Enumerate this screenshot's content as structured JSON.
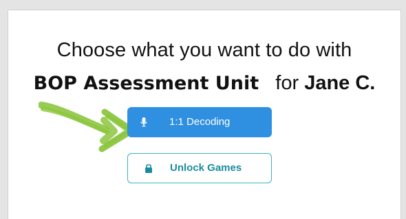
{
  "prompt": {
    "line1": "Choose what you want to do with",
    "unit_name": "BOP Assessment Unit",
    "connector": "for",
    "student_name": "Jane C."
  },
  "actions": {
    "decoding": {
      "label": "1:1 Decoding",
      "icon": "microphone-icon"
    },
    "unlock_games": {
      "label": "Unlock Games",
      "icon": "lock-icon"
    }
  },
  "colors": {
    "primary_button": "#2f8fe0",
    "secondary_border": "#39b0c2",
    "secondary_text": "#1a8c9c",
    "annotation_arrow": "#8cc63f"
  }
}
